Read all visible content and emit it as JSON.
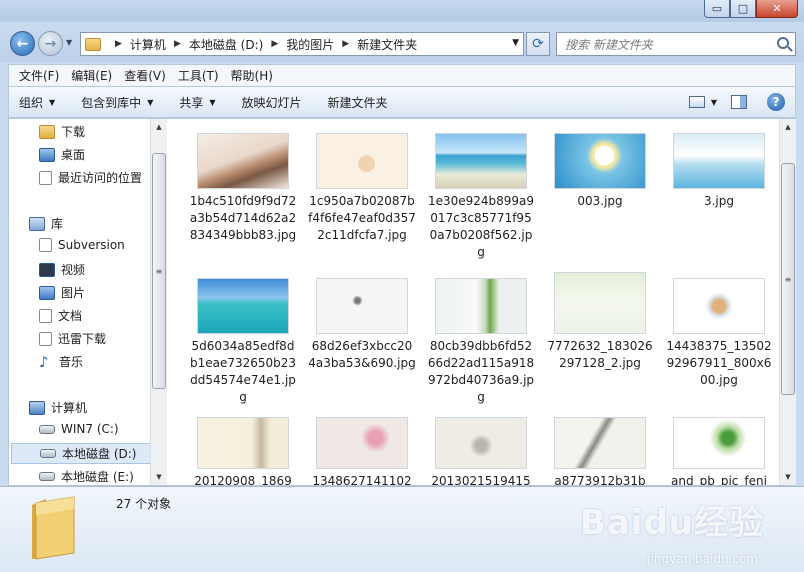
{
  "window": {
    "min_glyph": "▭",
    "max_glyph": "□",
    "close_glyph": "✕"
  },
  "nav": {
    "back_glyph": "←",
    "forward_glyph": "→"
  },
  "address": {
    "crumbs": [
      "计算机",
      "本地磁盘 (D:)",
      "我的图片",
      "新建文件夹"
    ]
  },
  "search": {
    "placeholder": "搜索 新建文件夹"
  },
  "menu": {
    "items": [
      "文件(F)",
      "编辑(E)",
      "查看(V)",
      "工具(T)",
      "帮助(H)"
    ]
  },
  "toolbar": {
    "organize": "组织",
    "include_in_library": "包含到库中",
    "share": "共享",
    "slideshow": "放映幻灯片",
    "new_folder": "新建文件夹",
    "help_glyph": "?"
  },
  "sidebar": {
    "favorites": [
      "下载",
      "桌面",
      "最近访问的位置"
    ],
    "libraries_title": "库",
    "libraries": [
      "Subversion",
      "视频",
      "图片",
      "文档",
      "迅雷下载",
      "音乐"
    ],
    "computer_title": "计算机",
    "drives": [
      "WIN7 (C:)",
      "本地磁盘 (D:)",
      "本地磁盘 (E:)"
    ],
    "selected": "本地磁盘 (D:)"
  },
  "files": [
    {
      "name": "1b4c510fd9f9d72a3b54d714d62a2834349bbb83.jpg",
      "thumb": "cat-bed"
    },
    {
      "name": "1c950a7b02087bf4f6fe47eaf0d3572c11dfcfa7.jpg",
      "thumb": "kitten"
    },
    {
      "name": "1e30e924b899a9017c3c85771f950a7b0208f562.jpg",
      "thumb": "beach"
    },
    {
      "name": "003.jpg",
      "thumb": "flower"
    },
    {
      "name": "3.jpg",
      "thumb": "umbrella"
    },
    {
      "name": "5d6034a85edf8db1eae732650b23dd54574e74e1.jpg",
      "thumb": "sea"
    },
    {
      "name": "68d26ef3xbcc204a3ba53&690.jpg",
      "thumb": "ink-birds"
    },
    {
      "name": "80cb39dbb6fd5266d22ad115a918972bd40736a9.jpg",
      "thumb": "plant"
    },
    {
      "name": "7772632_183026297128_2.jpg",
      "thumb": "birds-green"
    },
    {
      "name": "14438375_1350292967911_800x600.jpg",
      "thumb": "cup-hamster"
    },
    {
      "name": "20120908_1869",
      "thumb": "lady"
    },
    {
      "name": "1348627141102",
      "thumb": "blossom"
    },
    {
      "name": "2013021519415",
      "thumb": "still-life"
    },
    {
      "name": "a8773912b31b",
      "thumb": "orchid"
    },
    {
      "name": "and_pb_pic_feni",
      "thumb": "leaves"
    }
  ],
  "details": {
    "count": "27 个对象"
  },
  "watermark": {
    "main": "Baidu经验",
    "sub": "jingyan.baidu.com"
  }
}
